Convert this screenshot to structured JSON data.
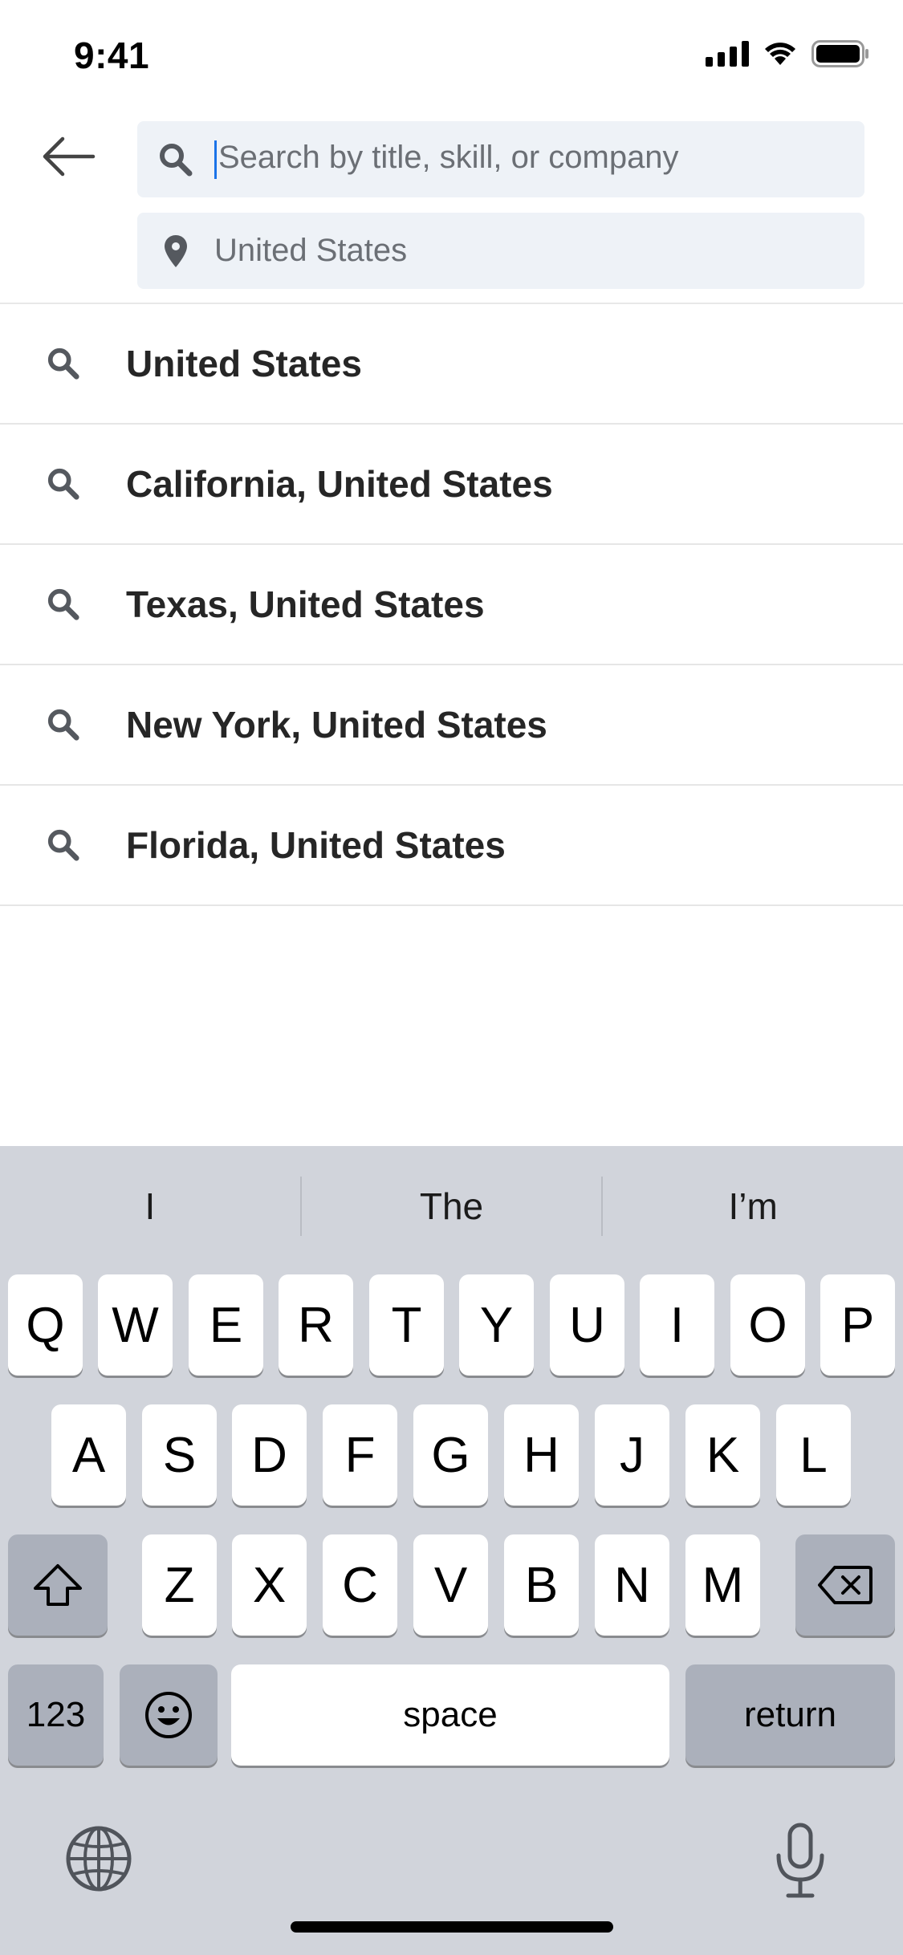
{
  "status_bar": {
    "time": "9:41"
  },
  "search": {
    "title_placeholder": "Search by title, skill, or company",
    "location_value": "United States"
  },
  "suggestions": [
    {
      "label": "United States"
    },
    {
      "label": "California, United States"
    },
    {
      "label": "Texas, United States"
    },
    {
      "label": "New York, United States"
    },
    {
      "label": "Florida, United States"
    }
  ],
  "keyboard": {
    "predictions": [
      "I",
      "The",
      "I’m"
    ],
    "row1": [
      "Q",
      "W",
      "E",
      "R",
      "T",
      "Y",
      "U",
      "I",
      "O",
      "P"
    ],
    "row2": [
      "A",
      "S",
      "D",
      "F",
      "G",
      "H",
      "J",
      "K",
      "L"
    ],
    "row3": [
      "Z",
      "X",
      "C",
      "V",
      "B",
      "N",
      "M"
    ],
    "numbers_label": "123",
    "space_label": "space",
    "return_label": "return"
  },
  "colors": {
    "search_bg": "#eef2f7",
    "keyboard_bg": "#d1d4db",
    "caret": "#1a73e8"
  }
}
